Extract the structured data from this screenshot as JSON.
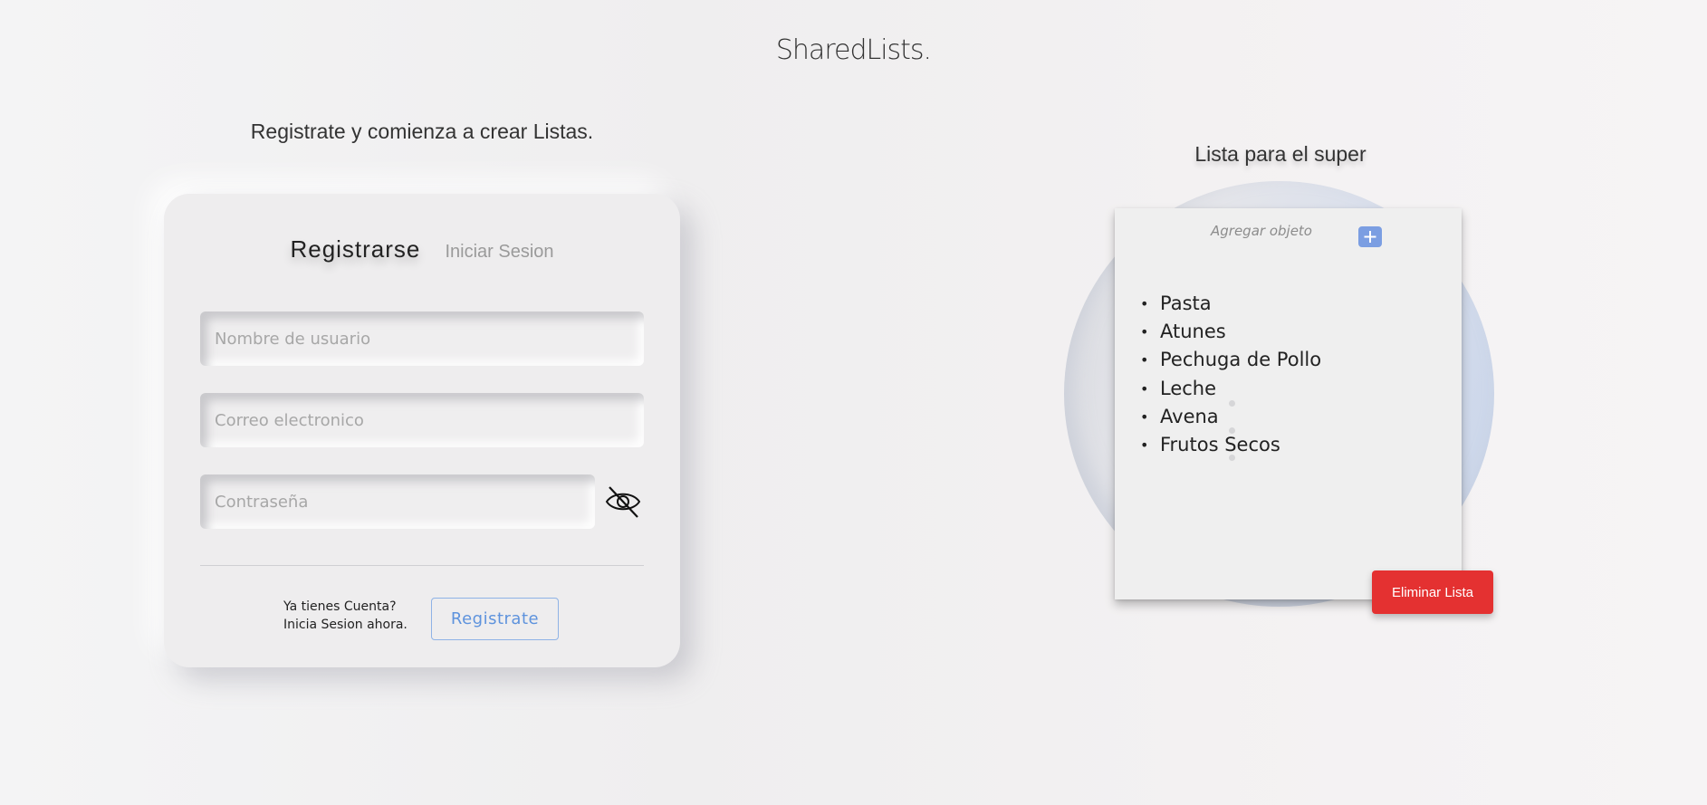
{
  "header": {
    "logo": "SharedLists."
  },
  "signup": {
    "subtitle": "Registrate y comienza a crear Listas.",
    "tabs": {
      "active": "Registrarse",
      "inactive": "Iniciar Sesion"
    },
    "fields": {
      "username_placeholder": "Nombre de usuario",
      "email_placeholder": "Correo electronico",
      "password_placeholder": "Contraseña",
      "username_value": "",
      "email_value": "",
      "password_value": ""
    },
    "footer": {
      "line1": "Ya tienes Cuenta?",
      "line2": "Inicia Sesion ahora.",
      "register_label": "Registrate"
    },
    "icons": {
      "password_toggle": "eye-slash-icon"
    }
  },
  "list_preview": {
    "title": "Lista para el super",
    "add_placeholder": "Agregar objeto",
    "add_icon": "plus-icon",
    "items": [
      "Pasta",
      "Atunes",
      "Pechuga de Pollo",
      "Leche",
      "Avena",
      "Frutos Secos"
    ],
    "delete_label": "Eliminar Lista"
  },
  "colors": {
    "accent_blue": "#5e93dd",
    "add_button": "#7b9ee2",
    "danger": "#e43131"
  }
}
